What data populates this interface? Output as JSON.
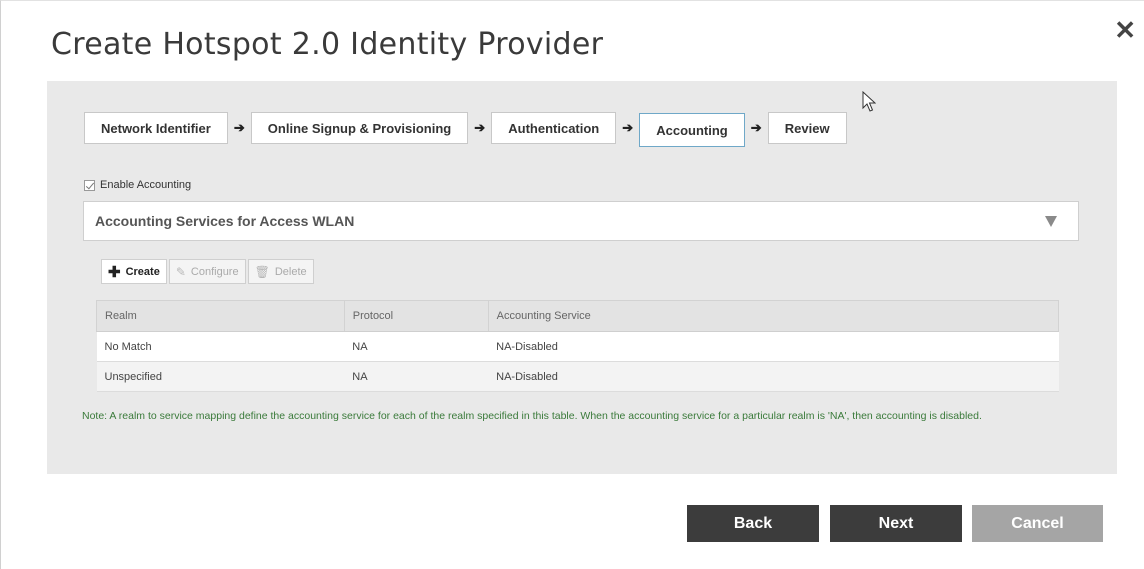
{
  "dialog": {
    "title": "Create Hotspot 2.0 Identity Provider",
    "close_glyph": "✕"
  },
  "wizard": {
    "steps": [
      {
        "label": "Network Identifier",
        "active": false
      },
      {
        "label": "Online Signup & Provisioning",
        "active": false
      },
      {
        "label": "Authentication",
        "active": false
      },
      {
        "label": "Accounting",
        "active": true
      },
      {
        "label": "Review",
        "active": false
      }
    ],
    "arrow_glyph": "➔"
  },
  "accounting": {
    "enable_label": "Enable Accounting",
    "enable_checked": true,
    "section_title": "Accounting Services for Access WLAN",
    "toolbar": {
      "create_label": "Create",
      "configure_label": "Configure",
      "delete_label": "Delete"
    },
    "table": {
      "headers": [
        "Realm",
        "Protocol",
        "Accounting Service"
      ],
      "rows": [
        [
          "No Match",
          "NA",
          "NA-Disabled"
        ],
        [
          "Unspecified",
          "NA",
          "NA-Disabled"
        ]
      ]
    },
    "note": "Note: A realm to service mapping define the accounting service for each of the realm specified in this table. When the accounting service for a particular realm is 'NA', then accounting is disabled."
  },
  "footer": {
    "back_label": "Back",
    "next_label": "Next",
    "cancel_label": "Cancel"
  },
  "colors": {
    "panel_bg": "#e9e9e9",
    "active_step_border": "#6fa8c8",
    "primary_button": "#3c3c3c",
    "cancel_button": "#a5a5a5",
    "note_text": "#3a7a3a"
  }
}
